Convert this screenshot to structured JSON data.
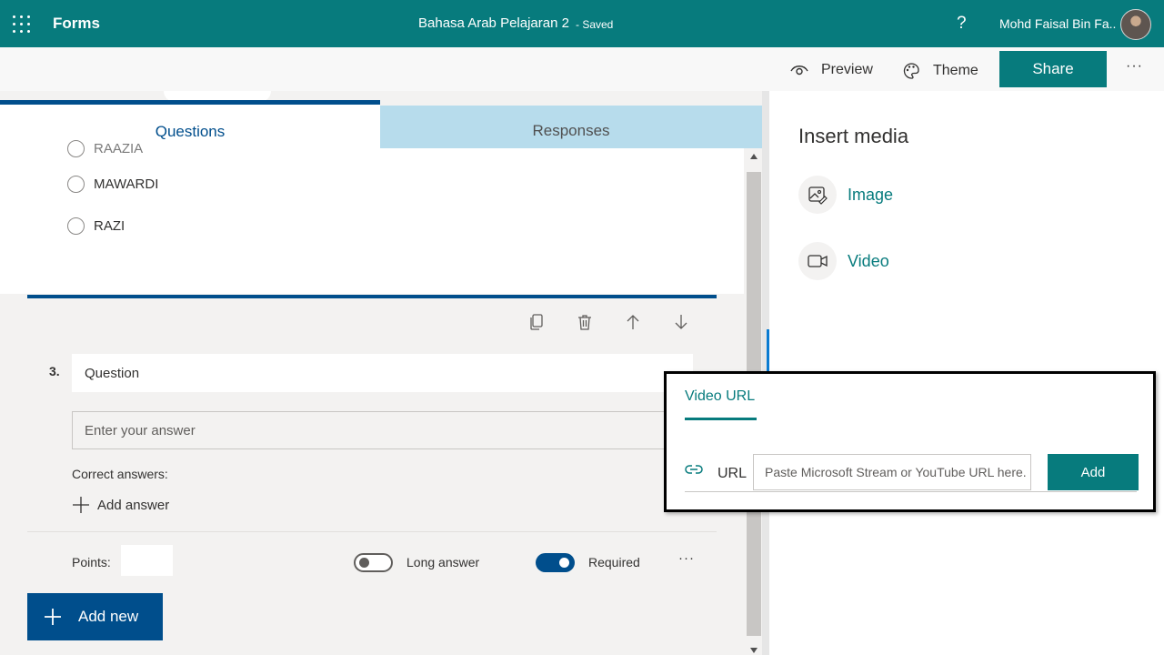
{
  "header": {
    "app_name": "Forms",
    "form_title": "Bahasa Arab Pelajaran 2",
    "form_status": "- Saved",
    "help_label": "?",
    "user_name": "Mohd Faisal Bin Fa..."
  },
  "toolbar": {
    "preview_label": "Preview",
    "theme_label": "Theme",
    "share_label": "Share",
    "more_label": "···"
  },
  "tabs": [
    {
      "label": "Questions",
      "active": true
    },
    {
      "label": "Responses",
      "active": false
    }
  ],
  "previous_question": {
    "options": [
      "RAAZIA",
      "MAWARDI",
      "RAZI"
    ]
  },
  "question": {
    "number": "3.",
    "title": "Question",
    "answer_placeholder": "Enter your answer",
    "correct_answers_label": "Correct answers:",
    "add_answer_label": "Add answer",
    "points_label": "Points:",
    "long_answer_label": "Long answer",
    "long_answer_on": false,
    "required_label": "Required",
    "required_on": true,
    "more_label": "···"
  },
  "add_new_label": "Add new",
  "insert_media": {
    "title": "Insert media",
    "items": [
      {
        "label": "Image",
        "icon": "image-icon"
      },
      {
        "label": "Video",
        "icon": "video-icon"
      }
    ]
  },
  "video_dialog": {
    "tab_label": "Video URL",
    "url_label": "URL",
    "url_placeholder": "Paste Microsoft Stream or YouTube URL here.",
    "add_label": "Add"
  },
  "colors": {
    "brand_teal": "#077b7d",
    "primary_blue": "#004e8c",
    "tab_inactive": "#b7dcec"
  }
}
